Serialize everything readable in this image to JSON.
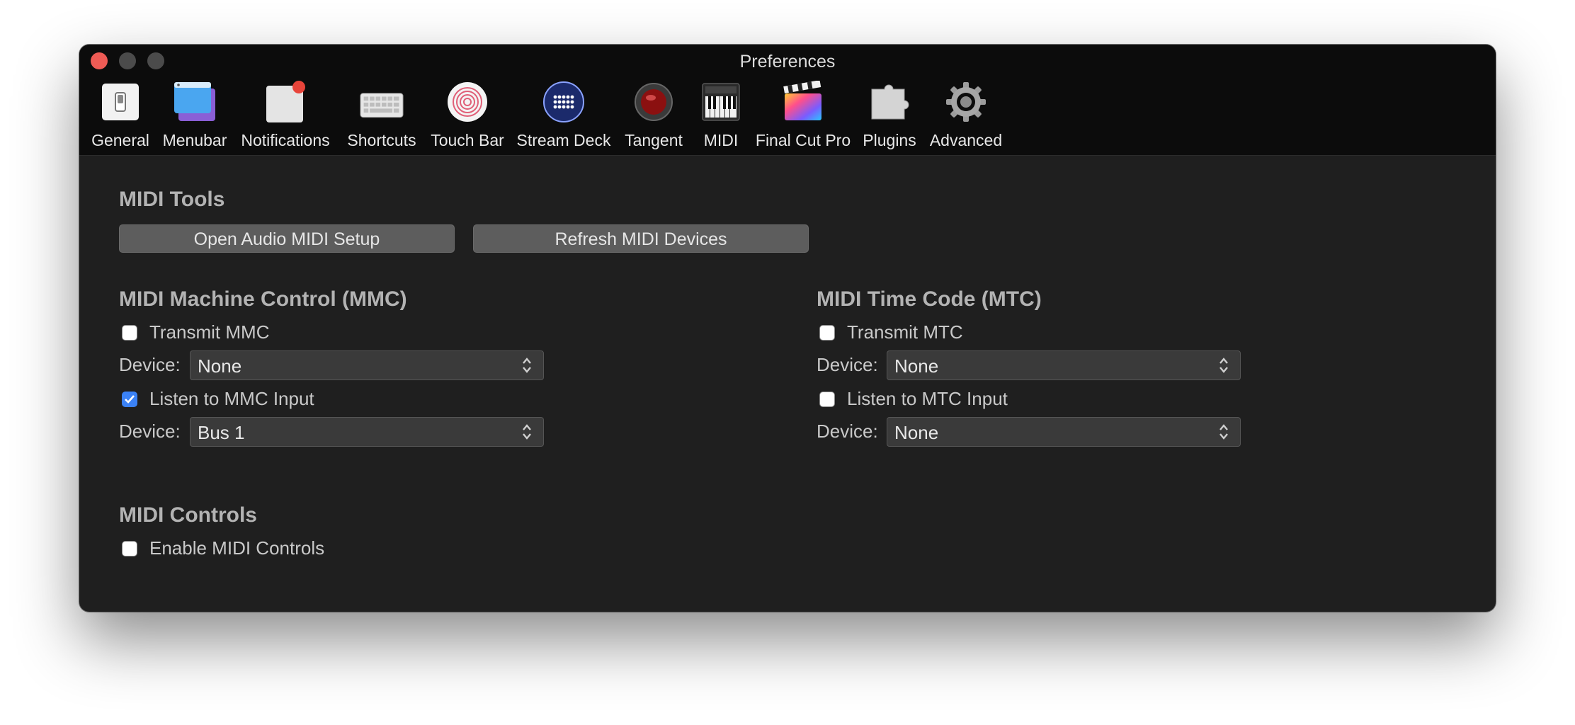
{
  "window": {
    "title": "Preferences"
  },
  "toolbar": {
    "tabs": [
      {
        "label": "General",
        "icon": "general-switch-icon"
      },
      {
        "label": "Menubar",
        "icon": "menubar-window-icon"
      },
      {
        "label": "Notifications",
        "icon": "notifications-icon"
      },
      {
        "label": "Shortcuts",
        "icon": "keyboard-icon"
      },
      {
        "label": "Touch Bar",
        "icon": "fingerprint-icon"
      },
      {
        "label": "Stream Deck",
        "icon": "stream-deck-icon"
      },
      {
        "label": "Tangent",
        "icon": "tangent-button-icon"
      },
      {
        "label": "MIDI",
        "icon": "piano-keyboard-icon"
      },
      {
        "label": "Final Cut Pro",
        "icon": "clapperboard-icon"
      },
      {
        "label": "Plugins",
        "icon": "puzzle-piece-icon"
      },
      {
        "label": "Advanced",
        "icon": "gear-icon"
      }
    ],
    "selected": "MIDI"
  },
  "midi_tools": {
    "heading": "MIDI Tools",
    "open_setup_label": "Open Audio MIDI Setup",
    "refresh_label": "Refresh MIDI Devices"
  },
  "mmc": {
    "heading": "MIDI Machine Control (MMC)",
    "transmit_label": "Transmit MMC",
    "transmit_checked": false,
    "transmit_device_label": "Device:",
    "transmit_device_value": "None",
    "listen_label": "Listen to MMC Input",
    "listen_checked": true,
    "listen_device_label": "Device:",
    "listen_device_value": "Bus 1"
  },
  "mtc": {
    "heading": "MIDI Time Code (MTC)",
    "transmit_label": "Transmit MTC",
    "transmit_checked": false,
    "transmit_device_label": "Device:",
    "transmit_device_value": "None",
    "listen_label": "Listen to MTC Input",
    "listen_checked": false,
    "listen_device_label": "Device:",
    "listen_device_value": "None"
  },
  "midi_controls": {
    "heading": "MIDI Controls",
    "enable_label": "Enable MIDI Controls",
    "enable_checked": false
  },
  "colors": {
    "window_bg": "#1f1f1f",
    "titlebar_bg": "#0c0c0c",
    "close_button": "#ee5b55",
    "checkbox_accent": "#3b82f6",
    "heading_text": "#b3b3b3"
  }
}
